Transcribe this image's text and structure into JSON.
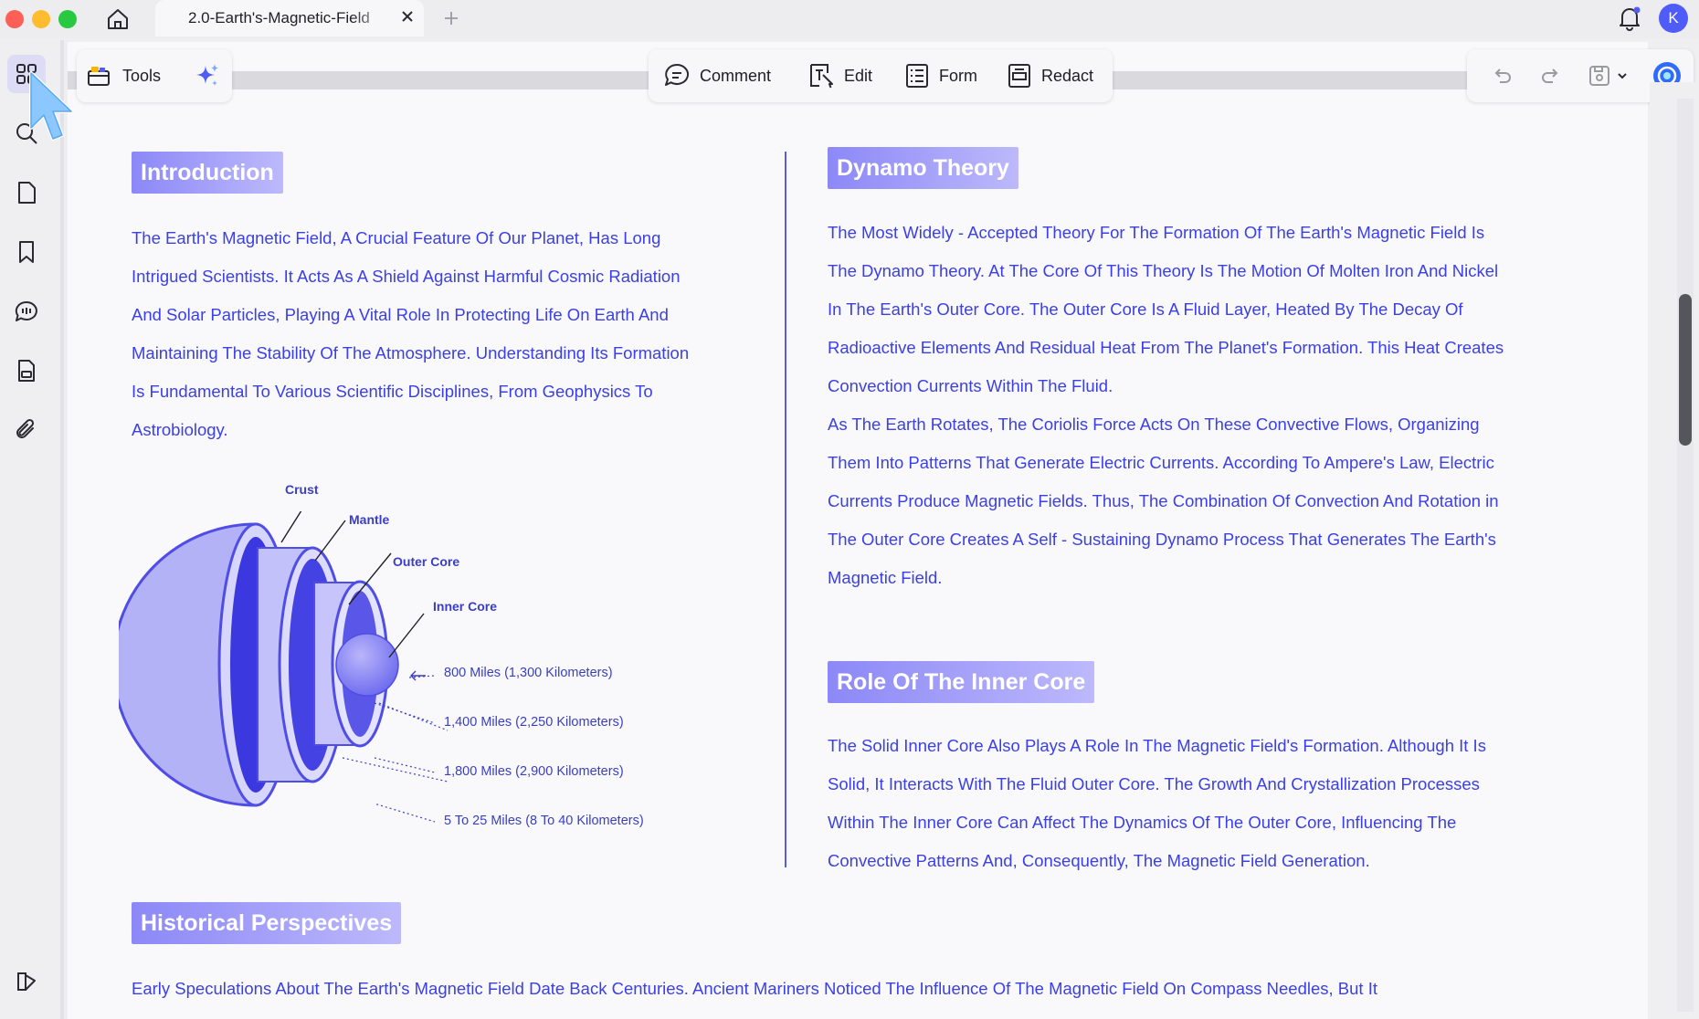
{
  "window": {
    "tab_title": "2.0-Earth's-Magnetic-Field",
    "avatar_initial": "K"
  },
  "toolbar": {
    "tools_label": "Tools",
    "comment_label": "Comment",
    "edit_label": "Edit",
    "form_label": "Form",
    "redact_label": "Redact"
  },
  "sidebar": {
    "items": [
      "thumbnails-icon",
      "search-icon",
      "page-icon",
      "bookmark-icon",
      "comments-icon",
      "stamp-icon",
      "attachment-icon"
    ],
    "bottom": "layers-icon"
  },
  "document": {
    "intro": {
      "heading": "Introduction",
      "lines": [
        "The Earth's Magnetic Field, A Crucial Feature Of Our Planet, Has Long",
        "Intrigued Scientists. It Acts As A Shield Against Harmful Cosmic Radiation",
        "And Solar Particles, Playing A Vital Role In Protecting Life On Earth And",
        "Maintaining The Stability Of The Atmosphere. Understanding Its Formation",
        "Is Fundamental To Various Scientific Disciplines, From Geophysics To",
        "Astrobiology."
      ]
    },
    "diagram": {
      "labels": {
        "crust": "Crust",
        "mantle": "Mantle",
        "outer_core": "Outer Core",
        "inner_core": "Inner Core"
      },
      "measurements": [
        "800 Miles (1,300 Kilometers)",
        "1,400 Miles (2,250 Kilometers)",
        "1,800 Miles (2,900 Kilometers)",
        "5 To 25 Miles (8 To 40 Kilometers)"
      ]
    },
    "dynamo": {
      "heading": "Dynamo Theory",
      "lines": [
        "The Most Widely - Accepted Theory For The Formation Of The Earth's Magnetic Field Is",
        "The Dynamo Theory. At The Core Of This Theory Is The Motion Of Molten Iron And Nickel",
        "In The Earth's Outer Core. The Outer Core Is A Fluid Layer, Heated By The Decay Of",
        "Radioactive Elements And Residual Heat From The Planet's Formation. This Heat Creates",
        "Convection Currents Within The Fluid.",
        "As The Earth Rotates, The Coriolis Force Acts On These Convective Flows, Organizing",
        "Them Into Patterns That Generate Electric Currents. According To Ampere's Law, Electric",
        "Currents Produce Magnetic Fields. Thus, The Combination Of Convection And Rotation in",
        "The Outer Core Creates A Self - Sustaining Dynamo Process That Generates The Earth's",
        "Magnetic Field."
      ]
    },
    "inner_core": {
      "heading": "Role Of The Inner Core",
      "lines": [
        "The Solid Inner Core Also Plays A Role In The Magnetic Field's Formation. Although It Is",
        "Solid, It Interacts With The Fluid Outer Core. The Growth And Crystallization Processes",
        "Within The Inner Core Can Affect The Dynamics Of The Outer Core, Influencing The",
        "Convective Patterns And, Consequently, The Magnetic Field Generation."
      ]
    },
    "historical": {
      "heading": "Historical Perspectives",
      "lines": [
        "Early Speculations About The Earth's Magnetic Field Date Back Centuries. Ancient Mariners Noticed The Influence Of The Magnetic Field On Compass Needles, But It"
      ]
    }
  },
  "colors": {
    "text_blue": "#3b3fe6",
    "heading_gradient_start": "#8c88f7",
    "heading_gradient_end": "#bdb9fb",
    "avatar": "#4f5cf8"
  }
}
